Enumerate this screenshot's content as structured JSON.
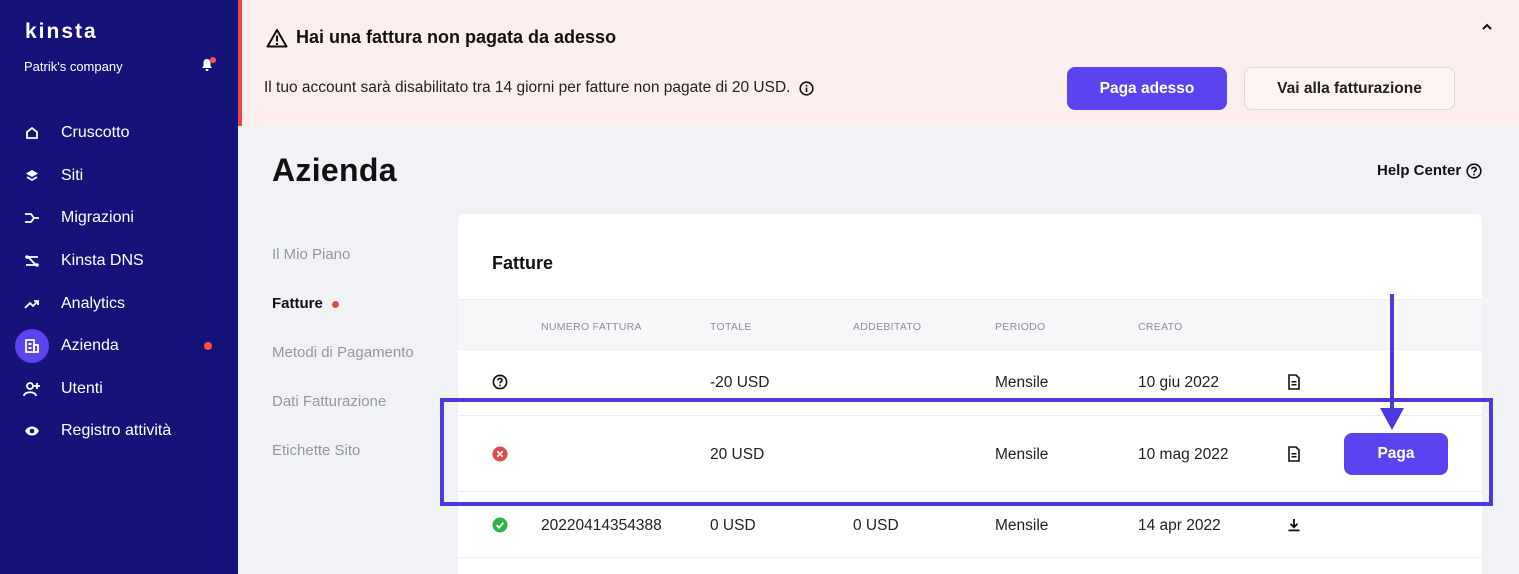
{
  "sidebar": {
    "logo": "kinsta",
    "company": "Patrik's company",
    "items": [
      {
        "label": "Cruscotto",
        "icon": "home-icon"
      },
      {
        "label": "Siti",
        "icon": "layers-icon"
      },
      {
        "label": "Migrazioni",
        "icon": "migrate-icon"
      },
      {
        "label": "Kinsta DNS",
        "icon": "dns-icon"
      },
      {
        "label": "Analytics",
        "icon": "trending-up-icon"
      },
      {
        "label": "Azienda",
        "icon": "building-icon",
        "active": true,
        "alert": true
      },
      {
        "label": "Utenti",
        "icon": "user-add-icon"
      },
      {
        "label": "Registro attività",
        "icon": "eye-icon"
      }
    ]
  },
  "alert": {
    "title": "Hai una fattura non pagata da adesso",
    "message": "Il tuo account sarà disabilitato tra 14 giorni per fatture non pagate di 20 USD.",
    "pay_now": "Paga adesso",
    "go_billing": "Vai alla fatturazione"
  },
  "page": {
    "title": "Azienda",
    "help_center": "Help Center"
  },
  "subnav": {
    "items": [
      {
        "label": "Il Mio Piano"
      },
      {
        "label": "Fatture",
        "active": true,
        "alert": true
      },
      {
        "label": "Metodi di Pagamento"
      },
      {
        "label": "Dati Fatturazione"
      },
      {
        "label": "Etichette Sito"
      }
    ]
  },
  "invoices": {
    "title": "Fatture",
    "columns": [
      "NUMERO FATTURA",
      "TOTALE",
      "ADDEBITATO",
      "PERIODO",
      "CREATO"
    ],
    "rows": [
      {
        "status": "pending",
        "number": "",
        "total": "-20 USD",
        "charged": "",
        "period": "Mensile",
        "created": "10 giu 2022",
        "action_icon": "document-icon"
      },
      {
        "status": "failed",
        "number": "",
        "total": "20 USD",
        "charged": "",
        "period": "Mensile",
        "created": "10 mag 2022",
        "action_icon": "document-icon",
        "button": "Paga"
      },
      {
        "status": "paid",
        "number": "20220414354388",
        "total": "0 USD",
        "charged": "0 USD",
        "period": "Mensile",
        "created": "14 apr 2022",
        "action_icon": "download-icon"
      }
    ]
  },
  "colors": {
    "sidebar_bg": "#15137a",
    "accent": "#5b44f0",
    "alert_bg": "#fceeee",
    "alert_border": "#e24a4a",
    "status_failed": "#e24a4a",
    "status_paid": "#2fb344",
    "annotation": "#4a3ae0"
  }
}
